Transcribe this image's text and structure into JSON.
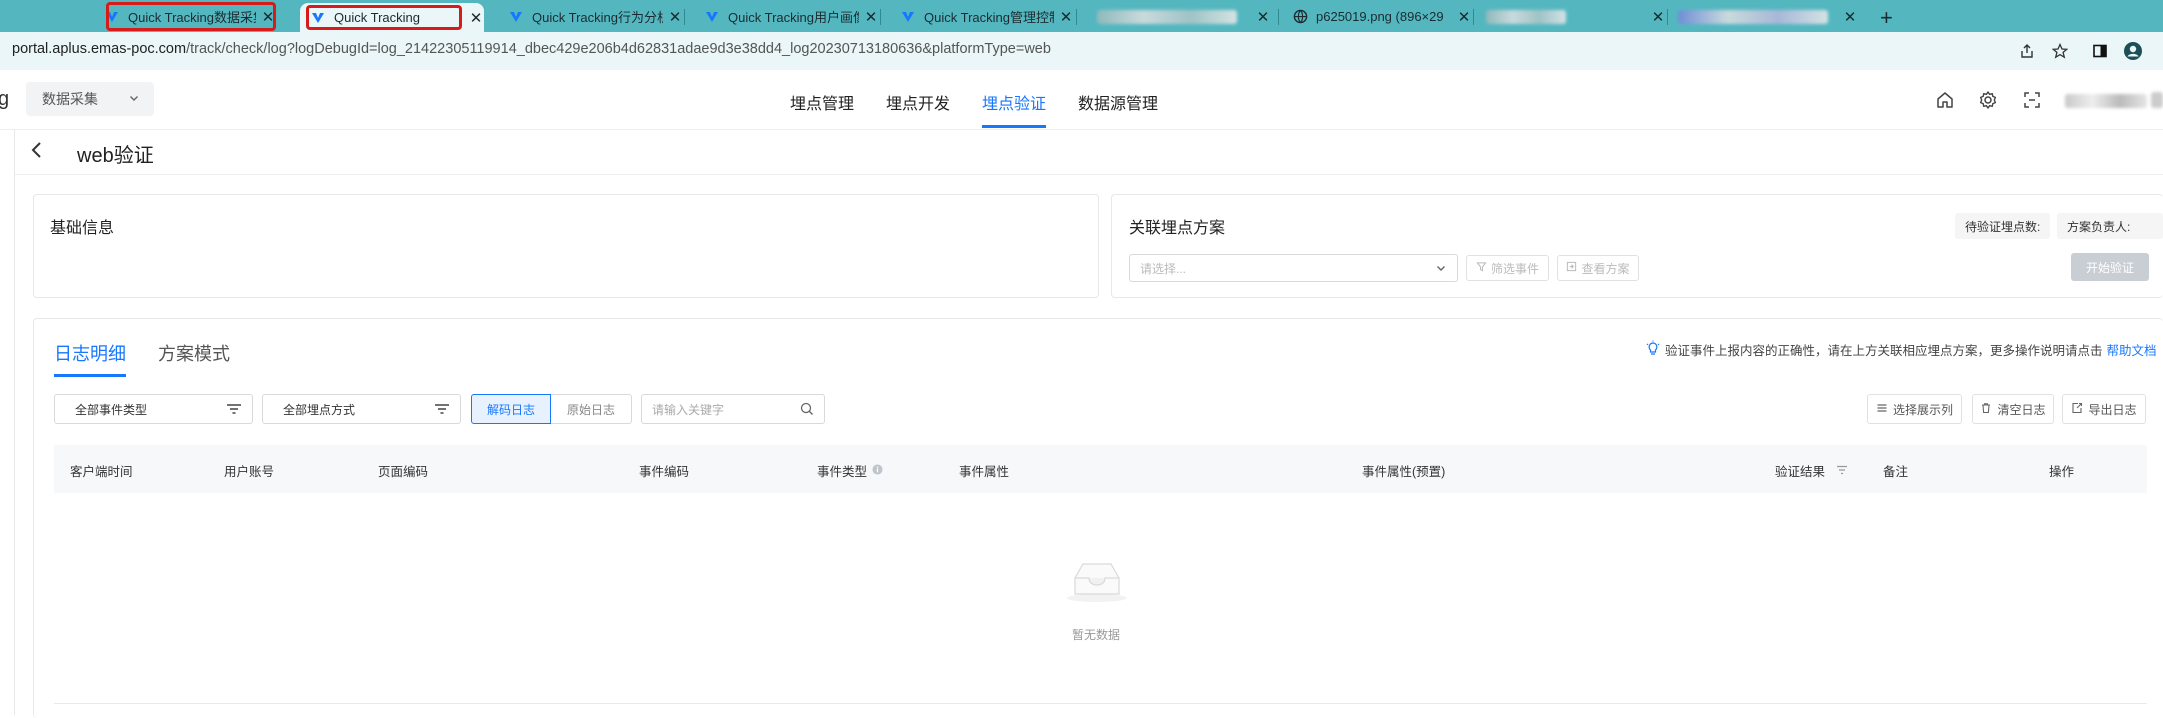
{
  "browser": {
    "tabs": [
      {
        "label": "Quick Tracking数据采集",
        "active": true
      },
      {
        "label": "Quick Tracking",
        "active": false
      },
      {
        "label": "Quick Tracking行为分析",
        "active": false
      },
      {
        "label": "Quick Tracking用户画像",
        "active": false
      },
      {
        "label": "Quick Tracking管理控制",
        "active": false
      },
      {
        "label": "",
        "active": false
      },
      {
        "label": "p625019.png (896×29",
        "active": false
      },
      {
        "label": "",
        "active": false
      },
      {
        "label": "",
        "active": false
      }
    ],
    "url_host": "portal.aplus.emas-poc.com",
    "url_path": "/track/check/log?logDebugId=log_21422305119914_dbec429e206b4d62831adae9d3e38dd4_log20230713180636&platformType=web"
  },
  "app": {
    "logo_fragment": "g",
    "app_switch": "数据采集",
    "nav": [
      {
        "label": "埋点管理",
        "active": false
      },
      {
        "label": "埋点开发",
        "active": false
      },
      {
        "label": "埋点验证",
        "active": true
      },
      {
        "label": "数据源管理",
        "active": false
      }
    ]
  },
  "page": {
    "title": "web验证"
  },
  "basic_info": {
    "title": "基础信息"
  },
  "plan": {
    "title": "关联埋点方案",
    "select_placeholder": "请选择...",
    "filter_events": "筛选事件",
    "view_plan": "查看方案",
    "pending_label": "待验证埋点数:",
    "owner_label": "方案负责人:",
    "start_button": "开始验证"
  },
  "log": {
    "tabs": [
      {
        "label": "日志明细",
        "active": true
      },
      {
        "label": "方案模式",
        "active": false
      }
    ],
    "hint_text": "验证事件上报内容的正确性，请在上方关联相应埋点方案，更多操作说明请点击",
    "hint_link": "帮助文档",
    "filter_event_type": "全部事件类型",
    "filter_track_method": "全部埋点方式",
    "seg_decoded": "解码日志",
    "seg_raw": "原始日志",
    "search_placeholder": "请输入关键字",
    "btn_columns": "选择展示列",
    "btn_clear": "清空日志",
    "btn_export": "导出日志",
    "columns": [
      "客户端时间",
      "用户账号",
      "页面编码",
      "事件编码",
      "事件类型",
      "事件属性",
      "事件属性(预置)",
      "验证结果",
      "备注",
      "操作"
    ],
    "empty_text": "暂无数据"
  },
  "colors": {
    "accent": "#1677ff",
    "tabbar": "#54b7c0",
    "highlight": "#d61b1b"
  }
}
